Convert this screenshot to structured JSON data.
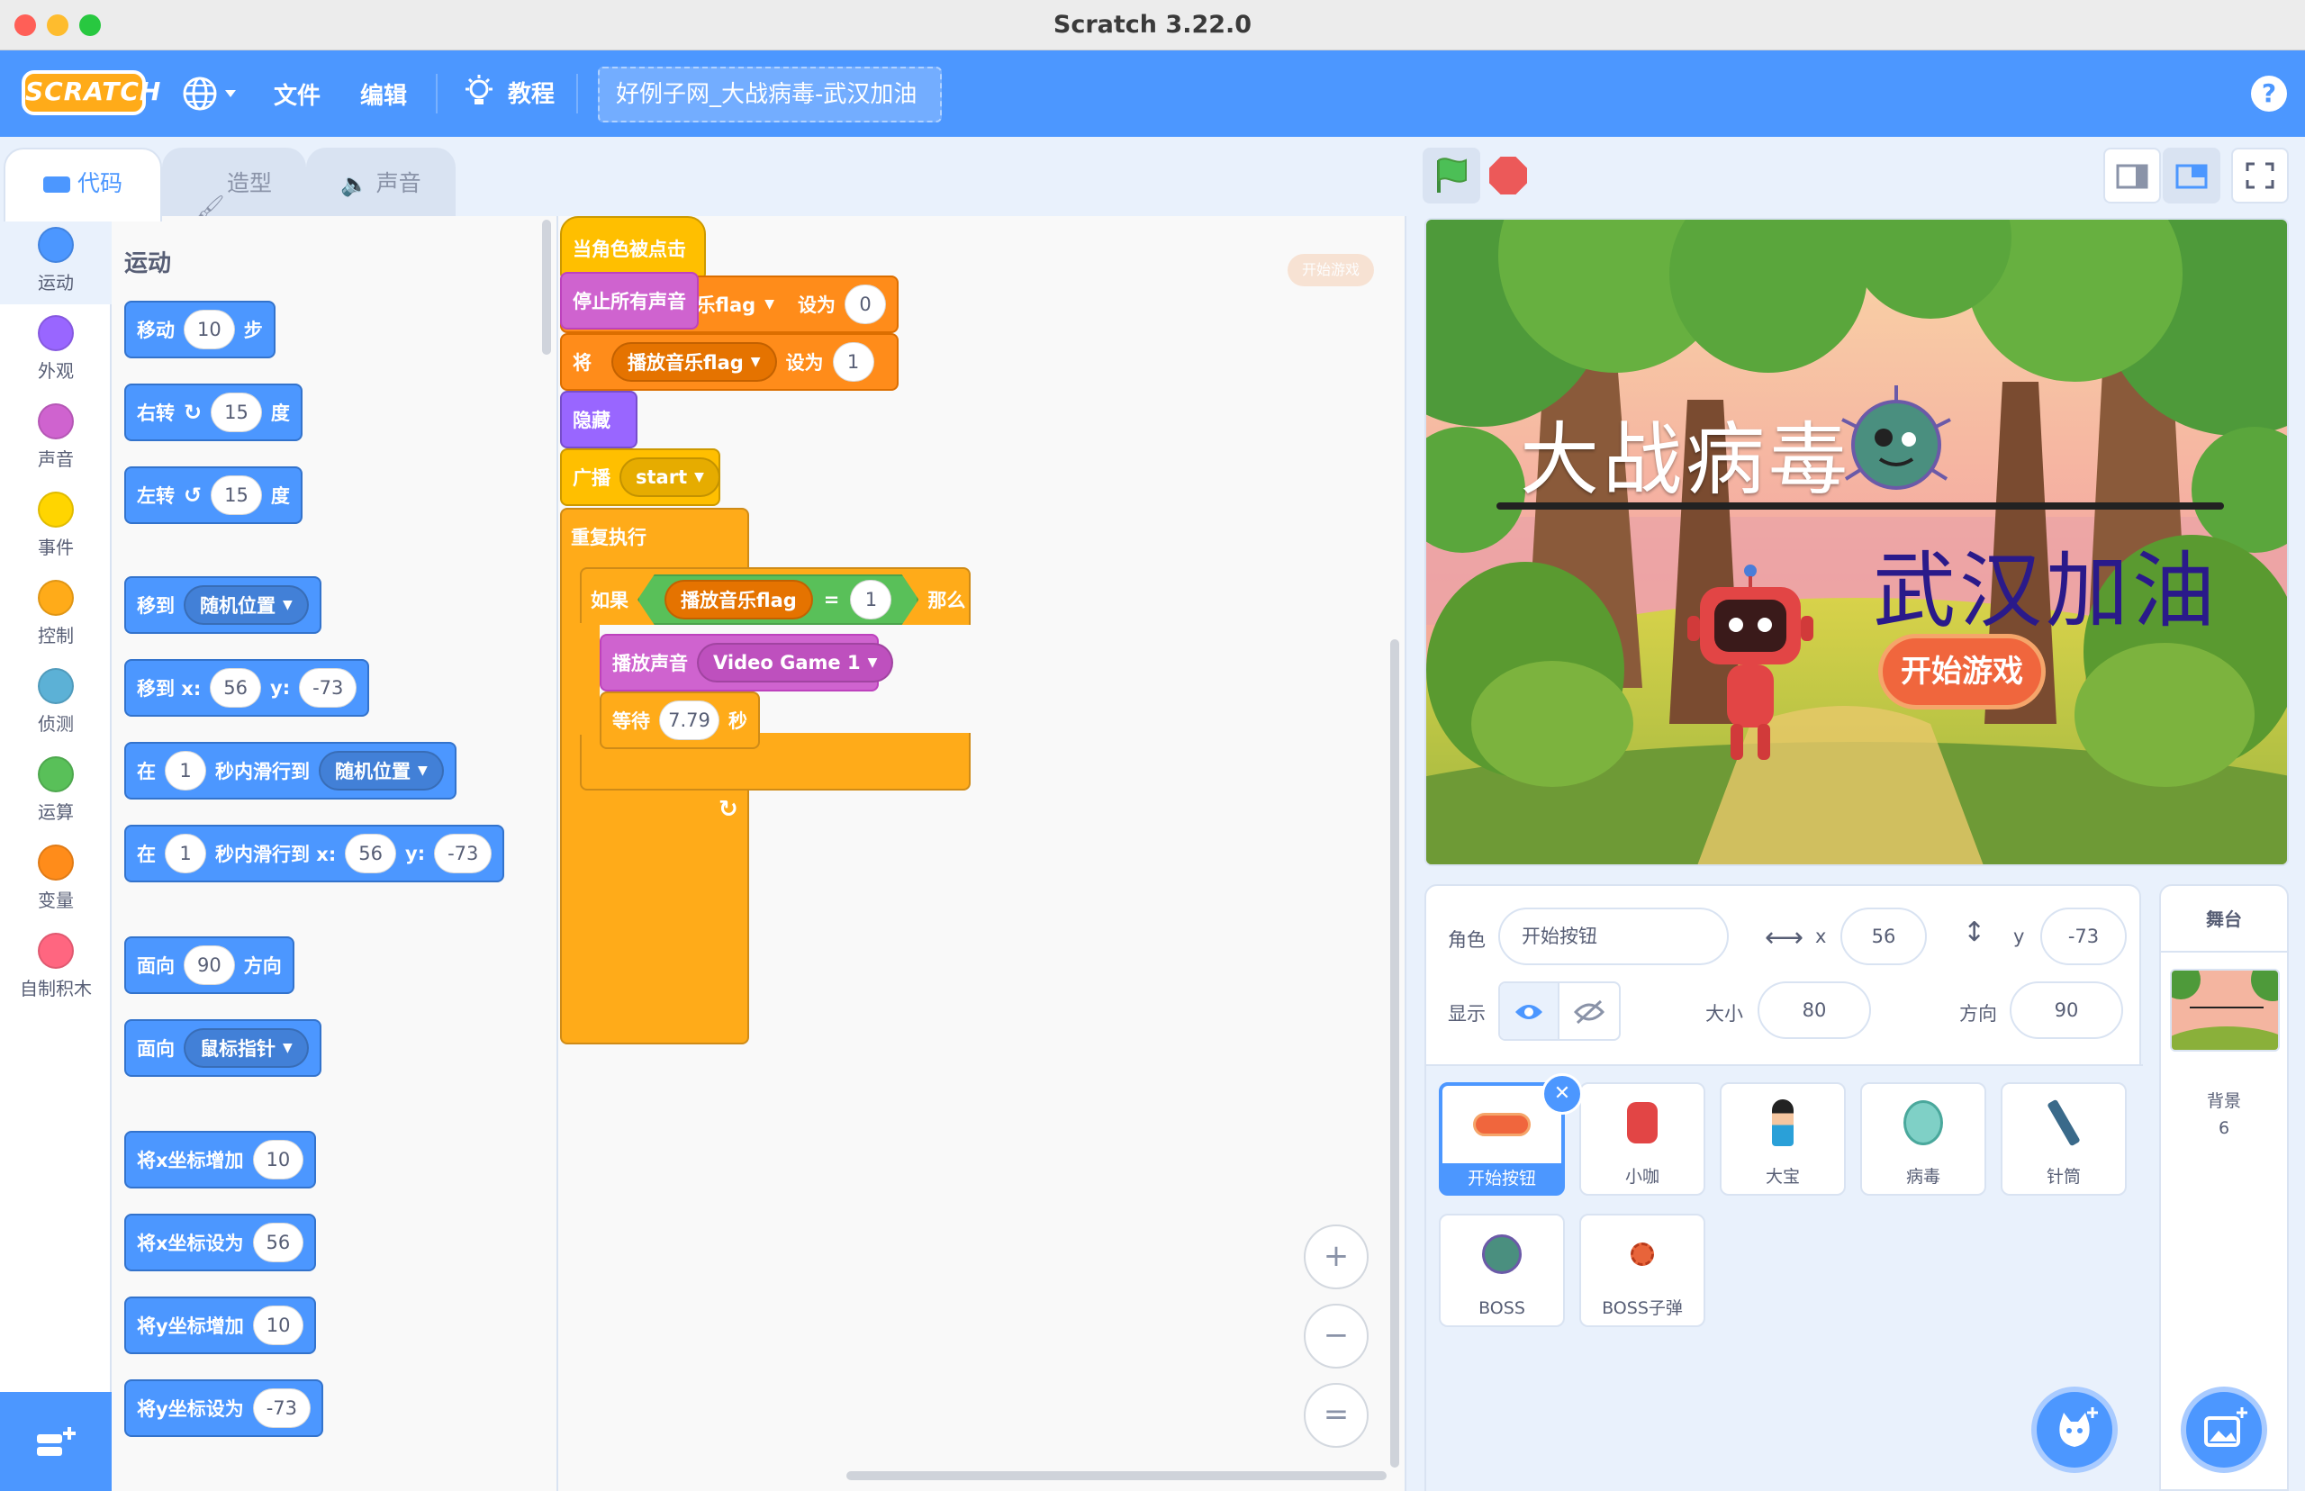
{
  "window": {
    "title": "Scratch 3.22.0"
  },
  "menubar": {
    "logo": "SCRATCH",
    "file": "文件",
    "edit": "编辑",
    "tutorials": "教程",
    "project_title": "好例子网_大战病毒-武汉加油",
    "help": "?"
  },
  "tabs": {
    "code": "代码",
    "costumes": "造型",
    "sounds": "声音"
  },
  "categories": [
    {
      "label": "运动",
      "color": "#4c97ff"
    },
    {
      "label": "外观",
      "color": "#9966ff"
    },
    {
      "label": "声音",
      "color": "#cf63cf"
    },
    {
      "label": "事件",
      "color": "#ffd500"
    },
    {
      "label": "控制",
      "color": "#ffab19"
    },
    {
      "label": "侦测",
      "color": "#5cb1d6"
    },
    {
      "label": "运算",
      "color": "#59c059"
    },
    {
      "label": "变量",
      "color": "#ff8c1a"
    },
    {
      "label": "自制积木",
      "color": "#ff6680"
    }
  ],
  "palette": {
    "heading": "运动",
    "move": {
      "a": "移动",
      "v": "10",
      "b": "步"
    },
    "turn_right": {
      "a": "右转",
      "v": "15",
      "b": "度"
    },
    "turn_left": {
      "a": "左转",
      "v": "15",
      "b": "度"
    },
    "goto": {
      "a": "移到",
      "dd": "随机位置"
    },
    "goto_xy": {
      "a": "移到 x:",
      "x": "56",
      "ylbl": "y:",
      "y": "-73"
    },
    "glide": {
      "a": "在",
      "v": "1",
      "b": "秒内滑行到",
      "dd": "随机位置"
    },
    "glide_xy": {
      "a": "在",
      "v": "1",
      "b": "秒内滑行到 x:",
      "x": "56",
      "ylbl": "y:",
      "y": "-73"
    },
    "point_dir": {
      "a": "面向",
      "v": "90",
      "b": "方向"
    },
    "point_towards": {
      "a": "面向",
      "dd": "鼠标指针"
    },
    "change_x": {
      "a": "将x坐标增加",
      "v": "10"
    },
    "set_x": {
      "a": "将x坐标设为",
      "v": "56"
    },
    "change_y": {
      "a": "将y坐标增加",
      "v": "10"
    },
    "set_y": {
      "a": "将y坐标设为",
      "v": "-73"
    }
  },
  "script": {
    "hat": "当角色被点击",
    "stop_sounds": "停止所有声音",
    "set1": {
      "var_tail": "乐flag",
      "to": "设为",
      "val": "0"
    },
    "set2": {
      "a": "将",
      "var": "播放音乐flag",
      "to": "设为",
      "val": "1"
    },
    "hide": "隐藏",
    "broadcast": {
      "a": "广播",
      "msg": "start"
    },
    "forever": "重复执行",
    "if": {
      "a": "如果",
      "var": "播放音乐flag",
      "op": "=",
      "val": "1",
      "then": "那么"
    },
    "play": {
      "a": "播放声音",
      "snd": "Video Game 1"
    },
    "wait": {
      "a": "等待",
      "v": "7.79",
      "b": "秒"
    },
    "loop_arrow": "↻",
    "sprite_thumb_label": "开始游戏"
  },
  "zoom": {
    "in": "+",
    "out": "−",
    "reset": "="
  },
  "stage": {
    "title": "大战病毒",
    "subtitle": "武汉加油",
    "start_button": "开始游戏"
  },
  "sprite_info": {
    "sprite_label": "角色",
    "sprite_name": "开始按钮",
    "x_label": "x",
    "x": "56",
    "y_label": "y",
    "y": "-73",
    "show_label": "显示",
    "size_label": "大小",
    "size": "80",
    "direction_label": "方向",
    "direction": "90"
  },
  "sprites": [
    {
      "name": "开始按钮"
    },
    {
      "name": "小咖"
    },
    {
      "name": "大宝"
    },
    {
      "name": "病毒"
    },
    {
      "name": "针筒"
    },
    {
      "name": "BOSS"
    },
    {
      "name": "BOSS子弹"
    }
  ],
  "stage_target": {
    "heading": "舞台",
    "backdrops_label": "背景",
    "backdrops_count": "6"
  }
}
